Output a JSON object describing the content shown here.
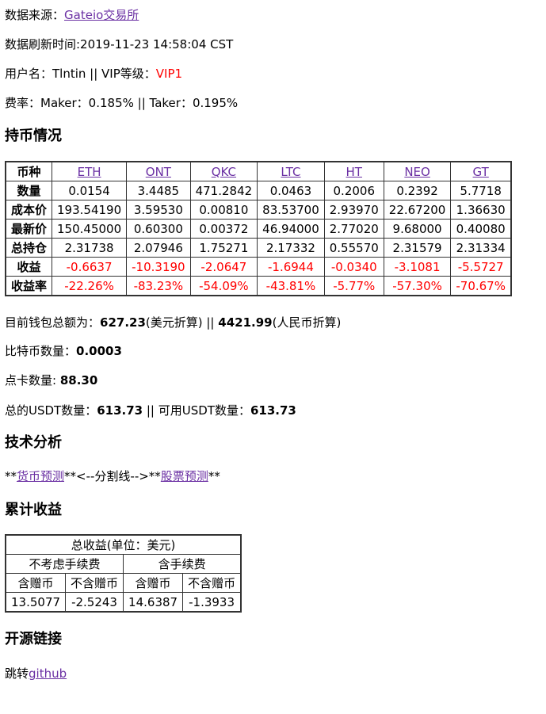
{
  "source": {
    "label": "数据来源：",
    "link": "Gateio交易所"
  },
  "refresh": {
    "text": "数据刷新时间:2019-11-23 14:58:04 CST"
  },
  "user": {
    "prefix": "用户名：Tlntin || VIP等级：",
    "vip": "VIP1"
  },
  "fee": {
    "text": "费率：Maker：0.185% || Taker：0.195%"
  },
  "holdings_title": "持币情况",
  "holdings": {
    "header_label": "币种",
    "coins": [
      "ETH",
      "ONT",
      "QKC",
      "LTC",
      "HT",
      "NEO",
      "GT"
    ],
    "rows": [
      {
        "label": "数量",
        "values": [
          "0.0154",
          "3.4485",
          "471.2842",
          "0.0463",
          "0.2006",
          "0.2392",
          "5.7718"
        ]
      },
      {
        "label": "成本价",
        "values": [
          "193.54190",
          "3.59530",
          "0.00810",
          "83.53700",
          "2.93970",
          "22.67200",
          "1.36630"
        ]
      },
      {
        "label": "最新价",
        "values": [
          "150.45000",
          "0.60300",
          "0.00372",
          "46.94000",
          "2.77020",
          "9.68000",
          "0.40080"
        ]
      },
      {
        "label": "总持仓",
        "values": [
          "2.31738",
          "2.07946",
          "1.75271",
          "2.17332",
          "0.55570",
          "2.31579",
          "2.31334"
        ]
      },
      {
        "label": "收益",
        "values": [
          "-0.6637",
          "-10.3190",
          "-2.0647",
          "-1.6944",
          "-0.0340",
          "-3.1081",
          "-5.5727"
        ]
      },
      {
        "label": "收益率",
        "values": [
          "-22.26%",
          "-83.23%",
          "-54.09%",
          "-43.81%",
          "-5.77%",
          "-57.30%",
          "-70.67%"
        ]
      }
    ]
  },
  "wallet": {
    "prefix": "目前钱包总额为：",
    "usd": "627.23",
    "usd_suffix": "(美元折算) || ",
    "cny": "4421.99",
    "cny_suffix": "(人民币折算)"
  },
  "btc": {
    "label": "比特币数量：",
    "value": "0.0003"
  },
  "points": {
    "label": "点卡数量: ",
    "value": "88.30"
  },
  "usdt": {
    "label1": "总的USDT数量：",
    "total": "613.73",
    "mid": " || 可用USDT数量：",
    "available": "613.73"
  },
  "analysis_title": "技术分析",
  "analysis": {
    "pre": "**",
    "link1": "货币预测",
    "mid": "**<--分割线-->**",
    "link2": "股票预测",
    "post": "**"
  },
  "profit_title": "累计收益",
  "profit": {
    "caption": "总收益(单位：美元)",
    "group1": "不考虑手续费",
    "group2": "含手续费",
    "sub": [
      "含赠币",
      "不含赠币",
      "含赠币",
      "不含赠币"
    ],
    "values": [
      "13.5077",
      "-2.5243",
      "14.6387",
      "-1.3933"
    ]
  },
  "opensource_title": "开源链接",
  "opensource": {
    "prefix": "跳转",
    "link": "github"
  },
  "colors": {
    "link": "#6a2fa3",
    "negative": "#ff0000"
  }
}
